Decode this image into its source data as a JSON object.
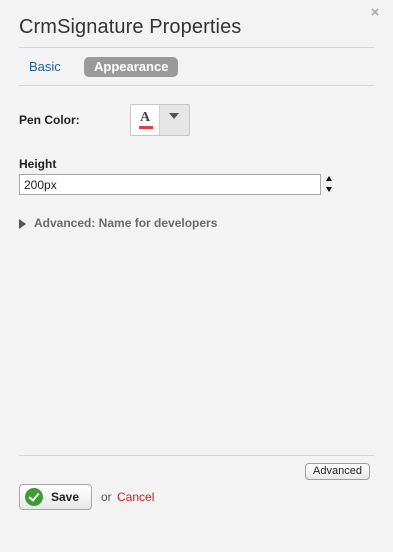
{
  "dialog": {
    "title": "CrmSignature Properties",
    "close_label": "×"
  },
  "tabs": [
    {
      "label": "Basic",
      "active": false
    },
    {
      "label": "Appearance",
      "active": true
    }
  ],
  "pen_color": {
    "label": "Pen Color:",
    "letter": "A",
    "value_color": "#d94040"
  },
  "height": {
    "label": "Height",
    "value": "200px"
  },
  "advanced_section": {
    "label": "Advanced: Name for developers",
    "expanded": false
  },
  "footer": {
    "advanced_button": "Advanced",
    "save_label": "Save",
    "or_text": "or",
    "cancel_label": "Cancel"
  },
  "colors": {
    "tab_active_bg": "#9a9a9a",
    "link_blue": "#1f62a8",
    "cancel_red": "#cc1f1f",
    "save_icon_green": "#3f9b33"
  }
}
